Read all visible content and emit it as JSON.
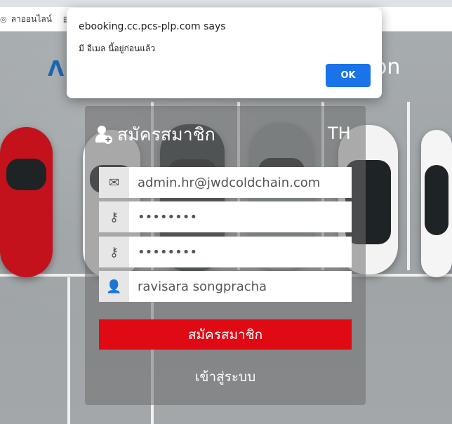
{
  "bookmarks": [
    {
      "label": "ลาออนไลน์",
      "icon": "globe-icon"
    },
    {
      "label": "",
      "icon": "document-icon"
    }
  ],
  "dialog": {
    "title": "ebooking.cc.pcs-plp.com says",
    "message": "มี อีเมล นี้อยู่ก่อนแล้ว",
    "ok_label": "OK"
  },
  "header": {
    "brand_tail": "on"
  },
  "form": {
    "title": "สมัครสมาชิก",
    "language": "TH",
    "email_value": "admin.hr@jwdcoldchain.com",
    "password_value": "••••••••",
    "confirm_password_value": "••••••••",
    "name_value": "ravisara songpracha",
    "submit_label": "สมัครสมาชิก",
    "login_label": "เข้าสู่ระบบ"
  },
  "colors": {
    "accent": "#e00a14",
    "dialog_button": "#1a73e8"
  }
}
